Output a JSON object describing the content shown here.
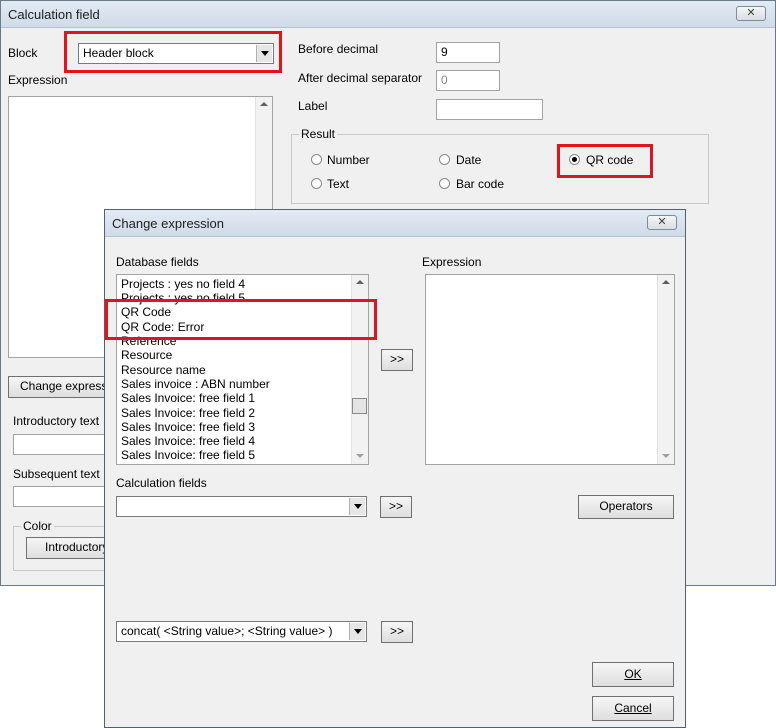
{
  "calc_window": {
    "title": "Calculation field",
    "close_glyph": "✕",
    "block_label": "Block",
    "block_value": "Header block",
    "expression_label": "Expression",
    "before_decimal_label": "Before decimal",
    "before_decimal_value": "9",
    "after_decimal_label": "After decimal separator",
    "after_decimal_value": "0",
    "label_label": "Label",
    "label_value": "",
    "result_group": "Result",
    "result_options": [
      "Number",
      "Date",
      "QR code",
      "Text",
      "Bar code"
    ],
    "result_selected": "QR code",
    "change_expression_button": "Change express",
    "introductory_text_label": "Introductory text",
    "subsequent_text_label": "Subsequent text",
    "color_group": "Color",
    "introductory_button": "Introductory"
  },
  "change_window": {
    "title": "Change expression",
    "close_glyph": "✕",
    "database_fields_label": "Database fields",
    "database_fields": [
      "Projects : yes no field 4",
      "Projects : yes no field 5",
      "QR Code",
      "QR Code: Error",
      "Reference",
      "Resource",
      "Resource name",
      "Sales invoice : ABN number",
      "Sales Invoice: free field 1",
      "Sales Invoice: free field 2",
      "Sales Invoice: free field 3",
      "Sales Invoice: free field 4",
      "Sales Invoice: free field 5"
    ],
    "add_field_button": ">>",
    "expression_label": "Expression",
    "expression_value": "",
    "calculation_fields_label": "Calculation fields",
    "calculation_fields_value": "",
    "add_calc_button": ">>",
    "operators_button": "Operators",
    "function_value": "concat( <String value>; <String value> )",
    "add_function_button": ">>",
    "ok_button": "OK",
    "cancel_button": "Cancel"
  },
  "highlight_color": "#e0141e"
}
